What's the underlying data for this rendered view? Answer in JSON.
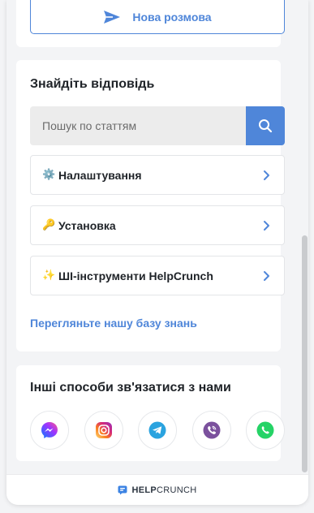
{
  "new_chat": {
    "label": "Нова розмова",
    "icon": "send-icon"
  },
  "knowledge_base": {
    "title": "Знайдіть відповідь",
    "search_placeholder": "Пошук по статтям",
    "categories": [
      {
        "emoji": "⚙️",
        "label": "Налаштування"
      },
      {
        "emoji": "🔑",
        "label": "Установка"
      },
      {
        "emoji": "✨",
        "label": "ШІ-інструменти HelpCrunch"
      }
    ],
    "browse_link": "Перегляньте нашу базу знань"
  },
  "contact": {
    "title": "Інші способи зв'язатися з нами",
    "channels": [
      "messenger-icon",
      "instagram-icon",
      "telegram-icon",
      "viber-icon",
      "whatsapp-icon"
    ]
  },
  "footer": {
    "brand_bold": "HELP",
    "brand_rest": "CRUNCH"
  },
  "colors": {
    "accent": "#4f86d9",
    "page_bg": "#f3f4f6"
  }
}
